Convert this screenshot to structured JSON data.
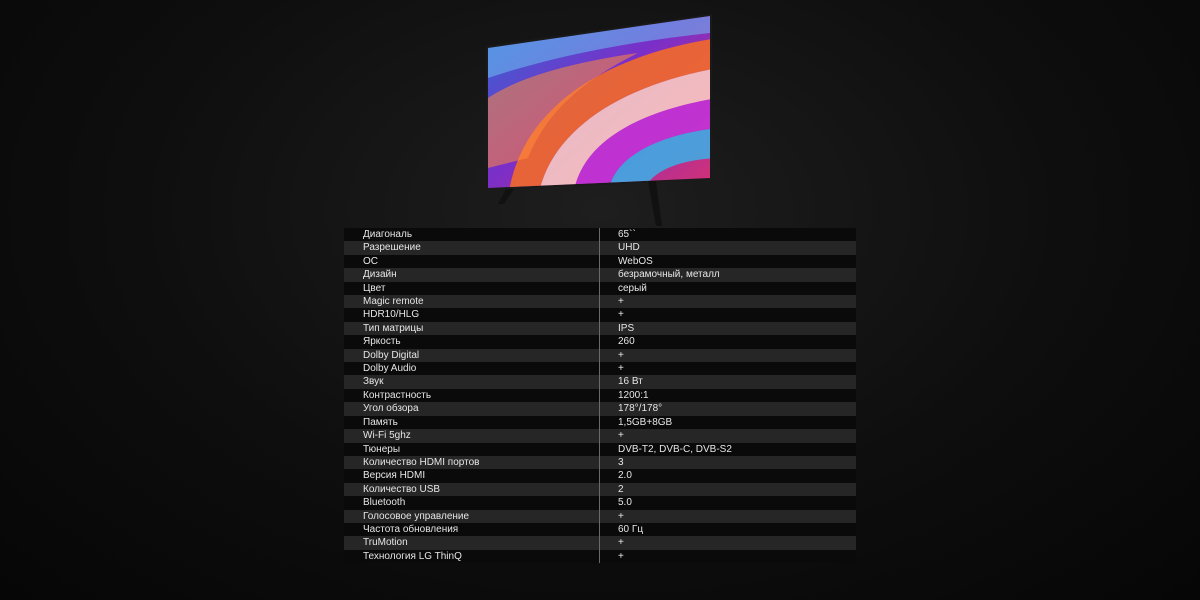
{
  "specs": [
    {
      "name": "Диагональ",
      "value": "65``"
    },
    {
      "name": "Разрешение",
      "value": "UHD"
    },
    {
      "name": "ОС",
      "value": "WebOS"
    },
    {
      "name": "Дизайн",
      "value": "безрамочный, металл"
    },
    {
      "name": "Цвет",
      "value": "серый"
    },
    {
      "name": "Magic remote",
      "value": "+"
    },
    {
      "name": "HDR10/HLG",
      "value": "+"
    },
    {
      "name": "Тип матрицы",
      "value": "IPS"
    },
    {
      "name": "Яркость",
      "value": "260"
    },
    {
      "name": "Dolby Digital",
      "value": "+"
    },
    {
      "name": "Dolby Audio",
      "value": "+"
    },
    {
      "name": "Звук",
      "value": "16 Вт"
    },
    {
      "name": "Контрастность",
      "value": "1200:1"
    },
    {
      "name": "Угол обзора",
      "value": "178°/178°"
    },
    {
      "name": "Память",
      "value": "1,5GB+8GB"
    },
    {
      "name": "Wi-Fi 5ghz",
      "value": "+"
    },
    {
      "name": "Тюнеры",
      "value": "DVB-T2, DVB-C, DVB-S2"
    },
    {
      "name": "Количество HDMI портов",
      "value": "3"
    },
    {
      "name": "Версия HDMI",
      "value": "2.0"
    },
    {
      "name": "Количество USB",
      "value": "2"
    },
    {
      "name": "Bluetooth",
      "value": "5.0"
    },
    {
      "name": "Голосовое управление",
      "value": "+"
    },
    {
      "name": "Частота обновления",
      "value": "60 Гц"
    },
    {
      "name": "TruMotion",
      "value": "+"
    },
    {
      "name": "Технология LG ThinQ",
      "value": "+"
    }
  ]
}
